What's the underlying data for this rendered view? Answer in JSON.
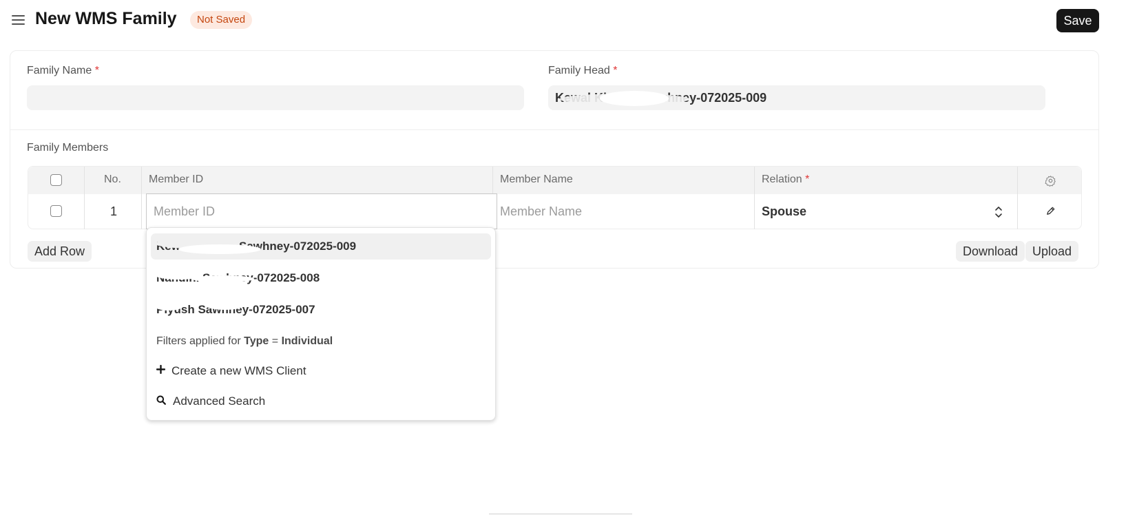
{
  "header": {
    "title": "New WMS Family",
    "status_badge": "Not Saved",
    "save_label": "Save"
  },
  "form": {
    "family_name": {
      "label": "Family Name",
      "required_mark": "*",
      "value": ""
    },
    "family_head": {
      "label": "Family Head",
      "required_mark": "*",
      "value": "Kewal Khasha Sawhney-072025-009"
    },
    "family_members": {
      "label": "Family Members",
      "columns": {
        "no": "No.",
        "member_id": "Member ID",
        "member_name": "Member Name",
        "relation": "Relation",
        "relation_required": "*"
      },
      "rows": [
        {
          "no": "1",
          "member_id_placeholder": "Member ID",
          "member_name_placeholder": "Member Name",
          "relation": "Spouse"
        }
      ],
      "add_row_label": "Add Row",
      "download_label": "Download",
      "upload_label": "Upload"
    }
  },
  "dropdown": {
    "options": [
      "Kewal Khasha Sawhney-072025-009",
      "Nandini Sawhney-072025-008",
      "Piyush Sawhney-072025-007"
    ],
    "filter_prefix": "Filters applied for ",
    "filter_field": "Type",
    "filter_op": " = ",
    "filter_value": "Individual",
    "create_label": "Create a new WMS Client",
    "advanced_label": "Advanced Search"
  },
  "colors": {
    "primary_button": "#171717",
    "badge_bg": "#fde9e0",
    "badge_text": "#c4460f",
    "required": "#e03636"
  }
}
